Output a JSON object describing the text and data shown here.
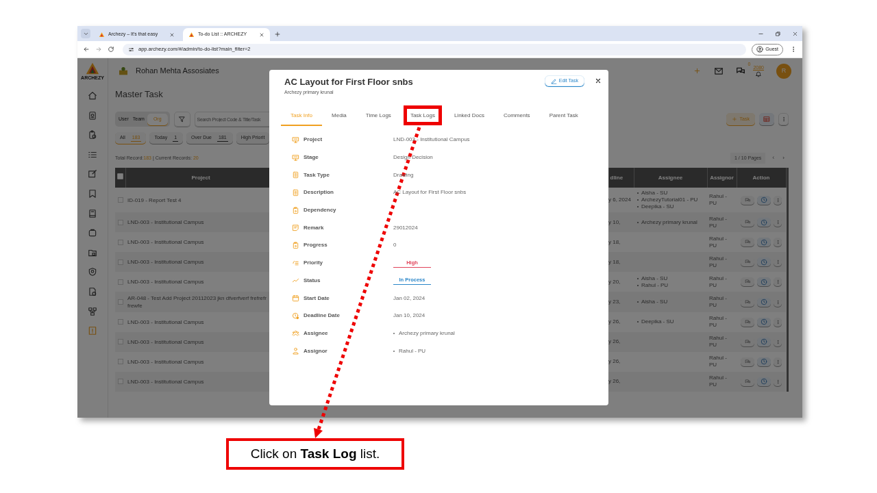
{
  "browser": {
    "tabs": [
      {
        "title": "Archezy – It's that easy",
        "selected": false
      },
      {
        "title": "To-do List :: ARCHEZY",
        "selected": true
      }
    ],
    "url": "app.archezy.com/#/admin/to-do-list?main_filter=2",
    "profile": "Guest"
  },
  "app": {
    "logo_text": "ARCHEZY",
    "company": "Rohan Mehta Assosiates",
    "chat_count": "0",
    "notification_count": "2080",
    "avatar": "R",
    "sidebar": {
      "items": [
        {
          "kind": "home",
          "selected": false
        },
        {
          "kind": "badge",
          "selected": false
        },
        {
          "kind": "clipboard",
          "selected": false
        },
        {
          "kind": "list",
          "selected": false
        },
        {
          "kind": "edit",
          "selected": false
        },
        {
          "kind": "bookmark",
          "selected": false
        },
        {
          "kind": "book",
          "selected": false
        },
        {
          "kind": "box",
          "selected": false
        },
        {
          "kind": "folder",
          "selected": false
        },
        {
          "kind": "shield",
          "selected": false
        },
        {
          "kind": "file",
          "selected": false
        },
        {
          "kind": "network",
          "selected": false
        },
        {
          "kind": "alert",
          "selected": true
        }
      ]
    },
    "page_title": "Master Task",
    "scope_toggle": [
      {
        "label": "User",
        "selected": false
      },
      {
        "label": "Team",
        "selected": false
      },
      {
        "label": "Org",
        "selected": true
      }
    ],
    "search": {
      "placeholder": "Search Project Code & Title/Task"
    },
    "filters": [
      {
        "label": "All",
        "count": "183",
        "selected": true
      },
      {
        "label": "Today",
        "count": "1",
        "selected": false
      },
      {
        "label": "Over Due",
        "count": "181",
        "selected": false
      },
      {
        "label": "High Priorit",
        "selected": false
      }
    ],
    "add_button": "Task",
    "summary": {
      "total_label": "Total Record:",
      "total": "183",
      "current_label": "| Current Records:",
      "current": "20"
    },
    "pagination": {
      "label": "1 / 10 Pages",
      "prev": "‹",
      "next": "›"
    },
    "table": {
      "select_all_checked": false,
      "columns": [
        {
          "label": "Project"
        },
        {
          "label": "dline"
        },
        {
          "label": "Assignee"
        },
        {
          "label": "Assignor"
        },
        {
          "label": "Action"
        }
      ],
      "rows": [
        {
          "checked": false,
          "project": "ID-019 - Report Test 4",
          "deadline": "y 6, 2024",
          "assignees": [
            "Aisha - SU",
            "ArchezyTutorial01 - PU",
            "Deepika - SU"
          ],
          "assignor": "Rahul - PU"
        },
        {
          "checked": false,
          "project": "LND-003 - Institutional Campus",
          "deadline": "y 10,",
          "assignees": [
            "Archezy primary krunal"
          ],
          "assignor": "Rahul - PU"
        },
        {
          "checked": false,
          "project": "LND-003 - Institutional Campus",
          "deadline": "y 18,",
          "assignor": "Rahul - PU"
        },
        {
          "checked": false,
          "project": "LND-003 - Institutional Campus",
          "deadline": "y 18,",
          "assignor": "Rahul - PU"
        },
        {
          "checked": false,
          "project": "LND-003 - Institutional Campus",
          "deadline": "y 20,",
          "assignees": [
            "Aisha - SU",
            "Rahul - PU"
          ],
          "assignor": "Rahul - PU"
        },
        {
          "checked": false,
          "project": "AR-048 - Test Add Project 20112023 jkn dfverfverf frefrefr frewfe",
          "deadline": "y 23,",
          "assignees": [
            "Aisha - SU"
          ],
          "assignor": "Rahul - PU"
        },
        {
          "checked": false,
          "project": "LND-003 - Institutional Campus",
          "deadline": "y 26,",
          "assignees": [
            "Deepika - SU"
          ],
          "assignor": "Rahul - PU"
        },
        {
          "checked": false,
          "project": "LND-003 - Institutional Campus",
          "deadline": "y 26,",
          "assignor": "Rahul - PU"
        },
        {
          "checked": false,
          "project": "LND-003 - Institutional Campus",
          "deadline": "y 26,",
          "assignor": "Rahul - PU"
        },
        {
          "checked": false,
          "project": "LND-003 - Institutional Campus",
          "deadline": "y 26,",
          "assignor": "Rahul - PU"
        }
      ]
    }
  },
  "modal": {
    "title": "AC Layout for First Floor snbs",
    "subtitle": "Archezy primary krunal",
    "edit_button": "Edit Task",
    "tabs": [
      {
        "label": "Task Info",
        "selected": true,
        "highlighted": false
      },
      {
        "label": "Media",
        "selected": false,
        "highlighted": false
      },
      {
        "label": "Time Logs",
        "selected": false,
        "highlighted": false
      },
      {
        "label": "Task Logs",
        "selected": false,
        "highlighted": true
      },
      {
        "label": "Linked Docs",
        "selected": false,
        "highlighted": false
      },
      {
        "label": "Comments",
        "selected": false,
        "highlighted": false
      },
      {
        "label": "Parent Task",
        "selected": false,
        "highlighted": false
      }
    ],
    "fields": [
      {
        "kind": "text",
        "label": "Project",
        "value": "LND-003 - Institutional Campus"
      },
      {
        "kind": "text",
        "label": "Stage",
        "value": "Design Decision"
      },
      {
        "kind": "text",
        "label": "Task Type",
        "value": "Drawing"
      },
      {
        "kind": "text",
        "label": "Description",
        "value": "AC Layout for First Floor snbs"
      },
      {
        "kind": "text",
        "label": "Dependency"
      },
      {
        "kind": "text",
        "label": "Remark",
        "value": "29012024"
      },
      {
        "kind": "text",
        "label": "Progress",
        "value": "0"
      },
      {
        "kind": "badge",
        "label": "Priority",
        "value": "High",
        "color": "#e0435a"
      },
      {
        "kind": "badge",
        "label": "Status",
        "value": "In Process",
        "color": "#2a86c9"
      },
      {
        "kind": "text",
        "label": "Start Date",
        "value": "Jan 02, 2024"
      },
      {
        "kind": "text",
        "label": "Deadline Date",
        "value": "Jan 10, 2024"
      },
      {
        "kind": "list",
        "label": "Assignee",
        "items": [
          "Archezy primary krunal"
        ]
      },
      {
        "kind": "list",
        "label": "Assignor",
        "items": [
          "Rahul - PU"
        ]
      }
    ]
  },
  "callout": {
    "caption": "Click on **Task Log** list."
  }
}
